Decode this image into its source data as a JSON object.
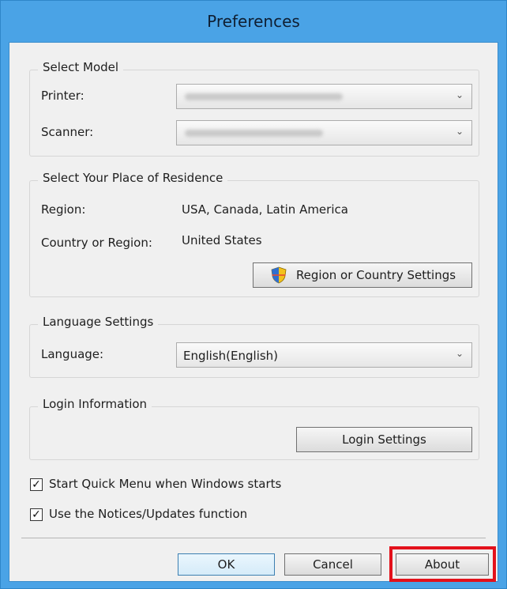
{
  "window": {
    "title": "Preferences"
  },
  "select_model": {
    "title": "Select Model",
    "printer_label": "Printer:",
    "scanner_label": "Scanner:"
  },
  "residence": {
    "title": "Select Your Place of Residence",
    "region_label": "Region:",
    "region_value": "USA, Canada, Latin America",
    "country_label": "Country or Region:",
    "country_value": "United States",
    "settings_button": "Region or Country Settings"
  },
  "language": {
    "title": "Language Settings",
    "label": "Language:",
    "value": "English(English)"
  },
  "login": {
    "title": "Login Information",
    "button": "Login Settings"
  },
  "options": [
    {
      "label": "Start Quick Menu when Windows starts",
      "checked": true
    },
    {
      "label": "Use the Notices/Updates function",
      "checked": true
    }
  ],
  "footer": {
    "ok": "OK",
    "cancel": "Cancel",
    "about": "About"
  },
  "colors": {
    "title_bar": "#4aa3e6",
    "highlight": "#e3111b"
  }
}
